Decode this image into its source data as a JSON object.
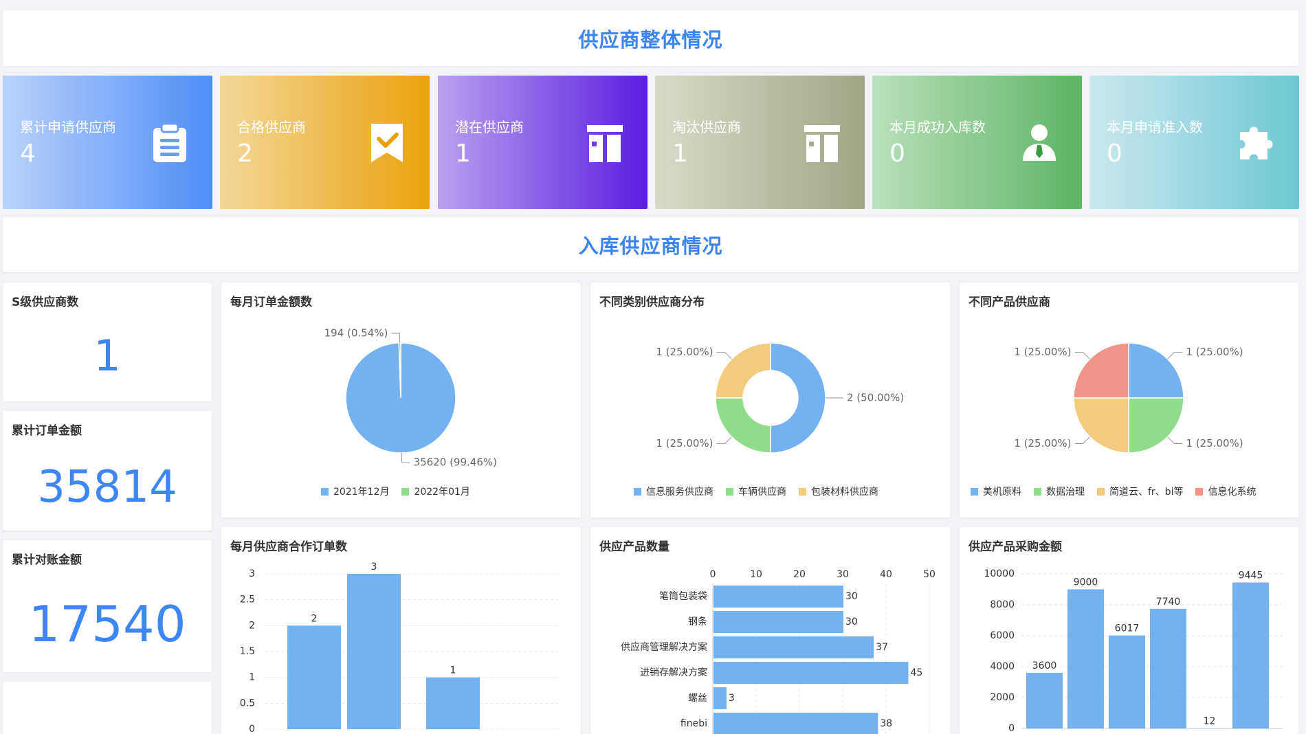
{
  "header": {
    "title": "供应商整体情况"
  },
  "stat_cards": [
    {
      "label": "累计申请供应商",
      "value": "4",
      "icon": "clipboard-icon",
      "from": "#b9d2fb",
      "to": "#4e8ef7"
    },
    {
      "label": "合格供应商",
      "value": "2",
      "icon": "checked-bookmark-icon",
      "from": "#f4d79a",
      "to": "#eaa20c"
    },
    {
      "label": "潜在供应商",
      "value": "1",
      "icon": "gift-box-icon",
      "from": "#b9a1ef",
      "to": "#5a1ee0"
    },
    {
      "label": "淘汰供应商",
      "value": "1",
      "icon": "gift-box-icon",
      "from": "#d7dbc8",
      "to": "#9fa687"
    },
    {
      "label": "本月成功入库数",
      "value": "0",
      "icon": "user-tie-icon",
      "from": "#b9e0bd",
      "to": "#5db562"
    },
    {
      "label": "本月申请准入数",
      "value": "0",
      "icon": "puzzle-icon",
      "from": "#cbe9ee",
      "to": "#6dc8d3"
    }
  ],
  "section2": {
    "title": "入库供应商情况"
  },
  "metrics": [
    {
      "title": "S级供应商数",
      "value": "1"
    },
    {
      "title": "累计订单金额",
      "value": "35814"
    },
    {
      "title": "累计对账金额",
      "value": "17540"
    }
  ],
  "colors": {
    "blue": "#73b1ef",
    "green": "#8fdc8b",
    "yellow": "#f2cb7f",
    "red": "#ee9488",
    "accent": "#3c84f0"
  },
  "chart_data": [
    {
      "type": "pie",
      "title": "每月订单金额数",
      "labels": [
        "2021年12月",
        "2022年01月"
      ],
      "values": [
        35620,
        194
      ],
      "data_labels": [
        "35620 (99.46%)",
        "194 (0.54%)"
      ],
      "colors": [
        "#73b1ef",
        "#8fdc8b"
      ],
      "legend": "bottom"
    },
    {
      "type": "pie",
      "title": "不同类别供应商分布",
      "donut": true,
      "labels": [
        "信息服务供应商",
        "车辆供应商",
        "包装材料供应商"
      ],
      "values": [
        2,
        1,
        1
      ],
      "data_labels": [
        "2 (50.00%)",
        "1 (25.00%)",
        "1 (25.00%)"
      ],
      "colors": [
        "#73b1ef",
        "#8fdc8b",
        "#f2cb7f"
      ],
      "legend": "bottom"
    },
    {
      "type": "pie",
      "title": "不同产品供应商",
      "labels": [
        "美机原料",
        "数据治理",
        "简道云、fr、bi等",
        "信息化系统"
      ],
      "values": [
        1,
        1,
        1,
        1
      ],
      "data_labels": [
        "1 (25.00%)",
        "1 (25.00%)",
        "1 (25.00%)",
        "1 (25.00%)"
      ],
      "colors": [
        "#73b1ef",
        "#8fdc8b",
        "#f2cb7f",
        "#ee9488"
      ],
      "legend": "bottom"
    },
    {
      "type": "bar",
      "title": "每月供应商合作订单数",
      "values": [
        2,
        3,
        1
      ],
      "ylim": [
        0,
        3
      ],
      "yticks": [
        "3",
        "2.5",
        "2",
        "1.5",
        "1",
        "0.5",
        "0"
      ],
      "grid": true
    },
    {
      "type": "bar",
      "orientation": "horizontal",
      "title": "供应产品数量",
      "categories": [
        "笔筒包装袋",
        "钢条",
        "供应商管理解决方案",
        "进销存解决方案",
        "螺丝",
        "finebi"
      ],
      "values": [
        30,
        30,
        37,
        45,
        3,
        38
      ],
      "xlim": [
        0,
        50
      ],
      "xticks": [
        "0",
        "10",
        "20",
        "30",
        "40",
        "50"
      ],
      "grid": true
    },
    {
      "type": "bar",
      "title": "供应产品采购金额",
      "values": [
        3600,
        9000,
        6017,
        7740,
        12,
        9445
      ],
      "ylim": [
        0,
        10000
      ],
      "yticks": [
        "10000",
        "8000",
        "6000",
        "4000",
        "2000",
        "0"
      ],
      "grid": true
    }
  ]
}
